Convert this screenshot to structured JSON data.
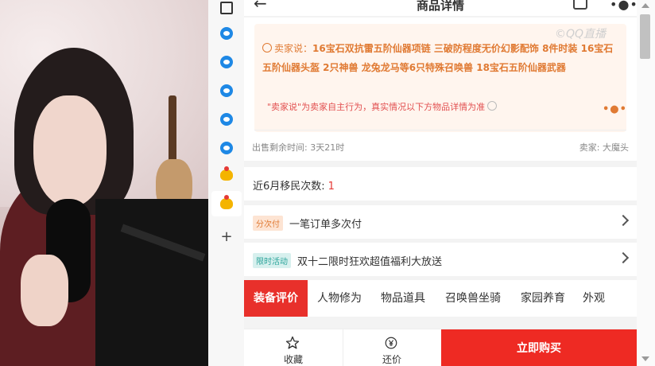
{
  "window": {
    "title": "商品详情"
  },
  "sidebar": {
    "icons": [
      "panel-icon",
      "edge-icon",
      "edge-icon",
      "edge-icon",
      "edge-icon",
      "edge-icon",
      "chick-icon",
      "chick-icon",
      "add-icon"
    ]
  },
  "seller_says": {
    "prefix": "卖家说：",
    "text": "16宝石双抗雷五阶仙器项链 三破防程度无价幻影配饰 8件时装 16宝石五阶仙器头盔 2只神兽 龙兔龙马等6只特殊召唤兽 18宝石五阶仙器武器",
    "disclaimer": "\"卖家说\"为卖家自主行为，真实情况以下方物品详情为准",
    "more": "•●•"
  },
  "sale_info": {
    "time_left": "出售剩余时间: 3天21时",
    "seller": "卖家: 大魔头"
  },
  "migrate": {
    "label": "近6月移民次数:",
    "count": "1"
  },
  "installment": {
    "tag": "分次付",
    "text": "一笔订单多次付"
  },
  "promo": {
    "tag": "限时活动",
    "text": "双十二限时狂欢超值福利大放送"
  },
  "tabs": [
    {
      "label": "装备评价",
      "active": true
    },
    {
      "label": "人物修为",
      "active": false
    },
    {
      "label": "物品道具",
      "active": false
    },
    {
      "label": "召唤兽坐骑",
      "active": false
    },
    {
      "label": "家园养育",
      "active": false
    },
    {
      "label": "外观",
      "active": false
    }
  ],
  "bottom": {
    "favorite": "收藏",
    "bargain": "还价",
    "buy_now": "立即购买"
  },
  "watermark": "©QQ直播",
  "colors": {
    "accent_red": "#ee2a23",
    "seller_says_text": "#e07a33",
    "disclaimer_red": "#e25050",
    "teal_tag": "#2aa39a"
  }
}
